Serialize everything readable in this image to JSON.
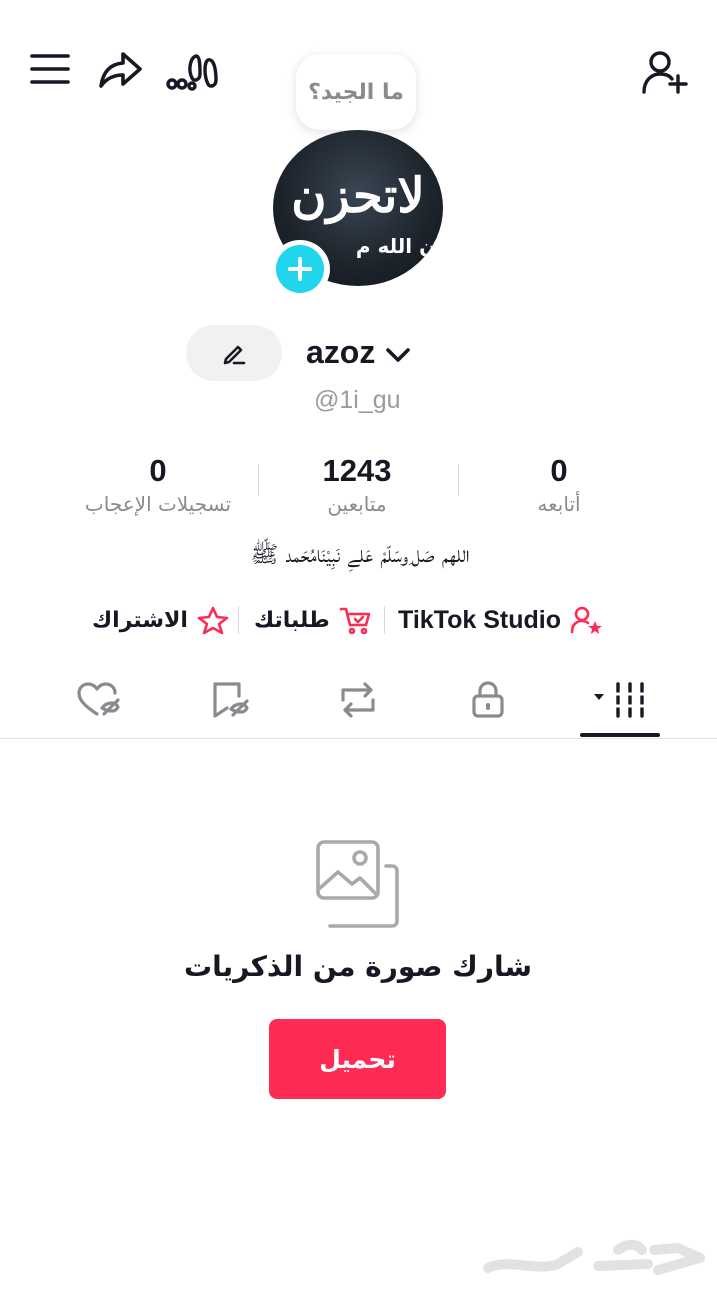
{
  "header": {
    "menu_icon": "hamburger-icon",
    "share_icon": "share-arrow-icon",
    "footprints_icon": "footprints-icon",
    "add_friend_icon": "add-user-icon"
  },
  "note": {
    "text": "ما الجيد؟"
  },
  "avatar": {
    "line1": "لاتحزن",
    "line2": "ان الله م",
    "add_icon": "plus-icon"
  },
  "profile": {
    "display_name": "azoz",
    "username": "@1i_gu",
    "edit_icon": "pencil-icon"
  },
  "stats": {
    "likes": {
      "count": "0",
      "label": "تسجيلات الإعجاب"
    },
    "followers": {
      "count": "1243",
      "label": "متابعين"
    },
    "following": {
      "count": "0",
      "label": "أتابعه"
    }
  },
  "bio": "اللهم صَل ِوسَلّمْ عَلےِ نَبِيْنَامُحَمد ﷺ",
  "links": {
    "studio": "TikTok Studio",
    "orders": "طلباتك",
    "subscription": "الاشتراك"
  },
  "tabs": [
    {
      "icon": "videos-grid-icon",
      "active": true
    },
    {
      "icon": "lock-icon",
      "active": false
    },
    {
      "icon": "repost-icon",
      "active": false
    },
    {
      "icon": "bookmark-hidden-icon",
      "active": false
    },
    {
      "icon": "heart-hidden-icon",
      "active": false
    }
  ],
  "empty_state": {
    "icon": "photo-stack-icon",
    "title": "شارك صورة من الذكريات",
    "button_label": "تحميل"
  },
  "colors": {
    "accent": "#fe2c55",
    "avatar_plus": "#20d5ec",
    "text_primary": "#161823",
    "text_secondary": "#8a8b91"
  },
  "watermark": "haraj-logo"
}
